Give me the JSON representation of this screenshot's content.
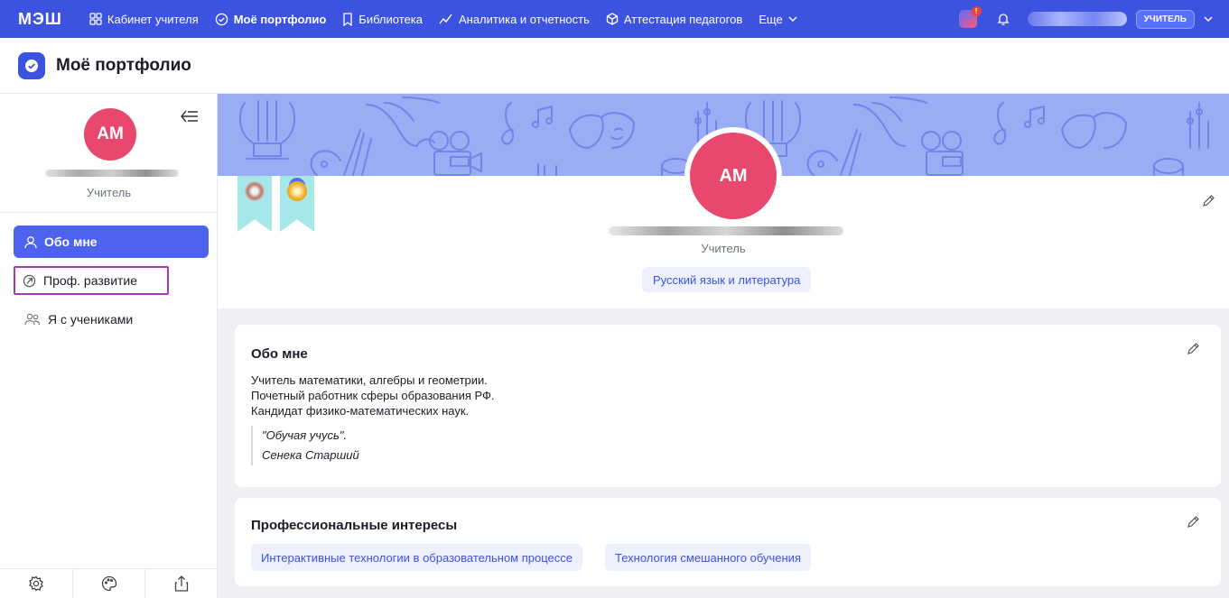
{
  "topnav": {
    "logo": "МЭШ",
    "items": [
      {
        "label": "Кабинет учителя",
        "icon": "grid-icon"
      },
      {
        "label": "Моё портфолио",
        "icon": "check-circle-icon"
      },
      {
        "label": "Библиотека",
        "icon": "bookmark-icon"
      },
      {
        "label": "Аналитика и отчетность",
        "icon": "chart-line-icon"
      },
      {
        "label": "Аттестация педагогов",
        "icon": "cube-icon"
      }
    ],
    "more_label": "Еще",
    "notification_badge": "!",
    "role_badge": "УЧИТЕЛЬ"
  },
  "page": {
    "title": "Моё портфолио"
  },
  "sidebar": {
    "avatar_initials": "АМ",
    "role": "Учитель",
    "items": [
      {
        "label": "Обо мне",
        "icon": "person-icon"
      },
      {
        "label": "Проф. развитие",
        "icon": "growth-icon"
      },
      {
        "label": "Я с учениками",
        "icon": "people-icon"
      }
    ],
    "bottom_icons": [
      "settings-icon",
      "palette-icon",
      "share-icon"
    ]
  },
  "profile": {
    "avatar_initials": "АМ",
    "role": "Учитель",
    "subject": "Русский язык и литература"
  },
  "about": {
    "title": "Обо мне",
    "lines": [
      "Учитель математики, алгебры и геометрии.",
      "Почетный работник сферы образования РФ.",
      "Кандидат физико-математических наук."
    ],
    "quote": "\"Обучая учусь\".",
    "quote_author": "Сенека Старший"
  },
  "interests": {
    "title": "Профессиональные интересы",
    "chips": [
      "Интерактивные технологии в образовательном процессе",
      "Технология смешанного обучения"
    ]
  },
  "colors": {
    "accent": "#3c53e0",
    "avatar": "#e8476e",
    "banner": "#9aacf3",
    "highlight_outline": "#a43bb8"
  }
}
